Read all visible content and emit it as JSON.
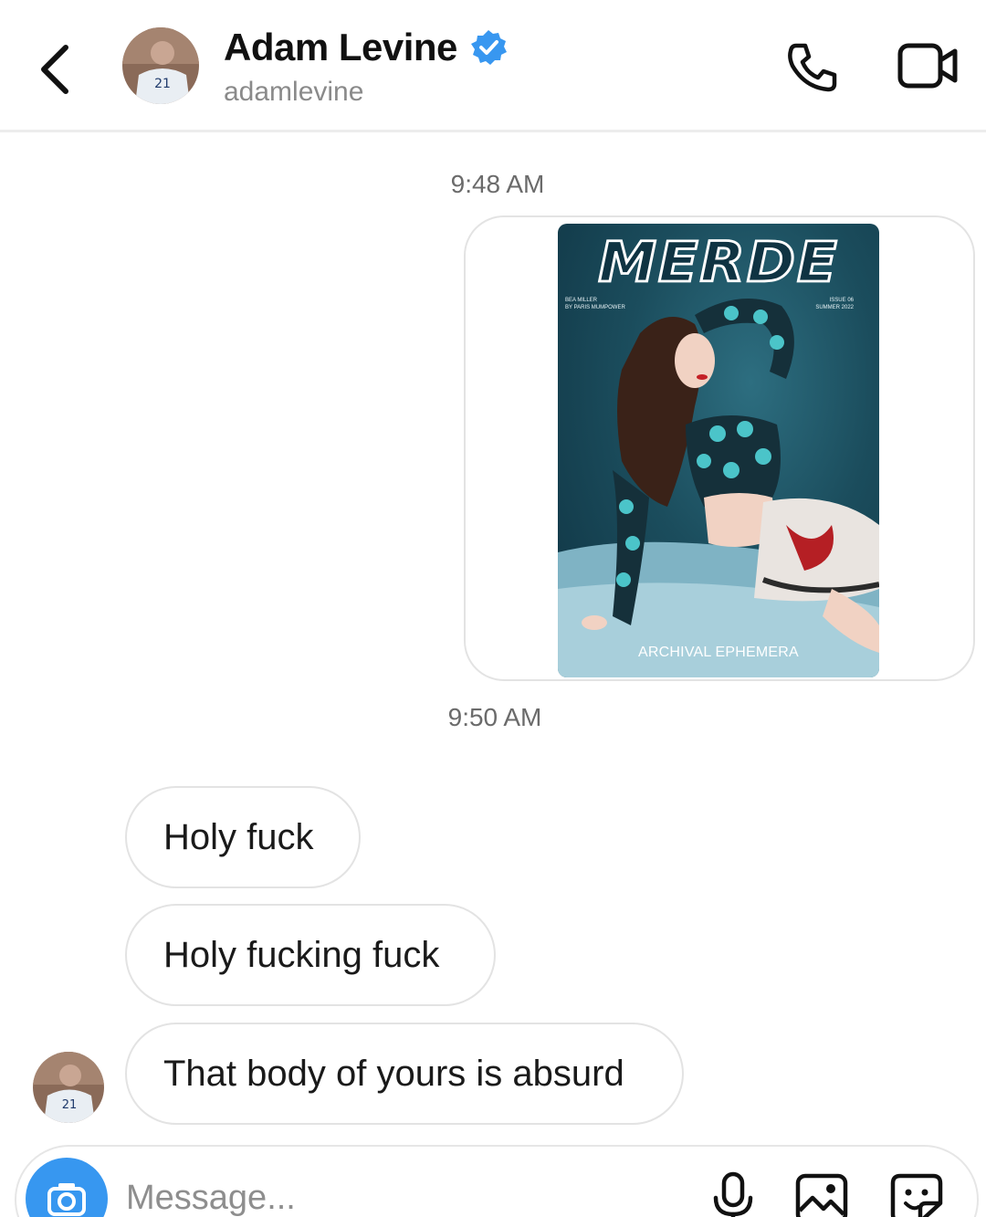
{
  "header": {
    "contact_name": "Adam Levine",
    "username": "adamlevine",
    "verified": true,
    "icons": [
      "chevron-left-icon",
      "verified-badge-icon",
      "phone-icon",
      "video-camera-icon"
    ]
  },
  "messages": {
    "timestamp_1": "9:48 AM",
    "shared_image": {
      "title": "MERDE",
      "meta_left": [
        "BEA MILLER",
        "BY PARIS MUMPOWER"
      ],
      "meta_right": [
        "ISSUE 06",
        "SUMMER 2022"
      ],
      "caption": "ARCHIVAL EPHEMERA"
    },
    "timestamp_2": "9:50 AM",
    "received": [
      {
        "text": "Holy fuck"
      },
      {
        "text": "Holy fucking fuck"
      },
      {
        "text": "That body of yours is absurd"
      }
    ]
  },
  "composer": {
    "placeholder": "Message...",
    "value": "",
    "icons": [
      "camera-icon",
      "microphone-icon",
      "gallery-icon",
      "sticker-icon"
    ]
  },
  "colors": {
    "accent": "#3797f0",
    "verified": "#3897f0",
    "bubble_border": "#e3e3e3",
    "muted_text": "#8a8a8a"
  }
}
